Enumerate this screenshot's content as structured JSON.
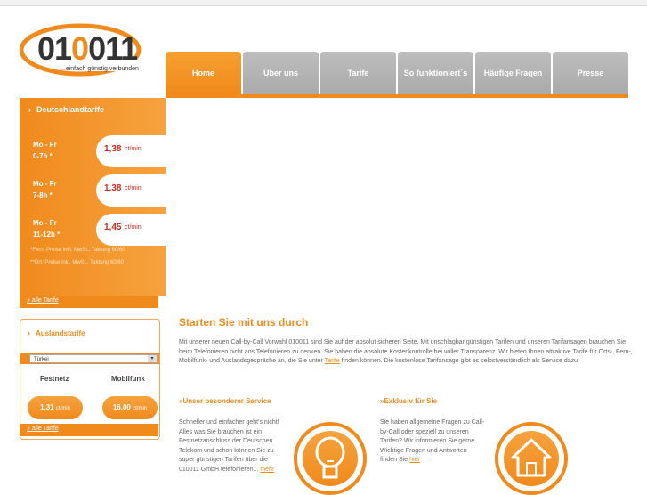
{
  "logo": {
    "text_prefix": "01",
    "text_mid": "0",
    "text_suffix": "011",
    "slogan": "...einfach günstig verbunden"
  },
  "nav": {
    "tabs": [
      {
        "label": "Home",
        "active": true
      },
      {
        "label": "Über uns"
      },
      {
        "label": "Tarife"
      },
      {
        "label": "So funktioniert´s"
      },
      {
        "label": "Häufige Fragen"
      },
      {
        "label": "Presse"
      }
    ]
  },
  "deutschland": {
    "title": "Deutschlandtarife",
    "rates": [
      {
        "day": "Mo - Fr",
        "time": "0-7h *",
        "price": "1,38",
        "unit": "ct/min"
      },
      {
        "day": "Mo - Fr",
        "time": "7-8h *",
        "price": "1,38",
        "unit": "ct/min"
      },
      {
        "day": "Mo - Fr",
        "time": "11-12h *",
        "price": "1,45",
        "unit": "ct/min"
      }
    ],
    "footnote1": "*Fern: Preise inkl. MwSt., Taktung 60/60",
    "footnote2": "**Ort: Preise inkl. MwSt., Taktung 60/60",
    "link": "» alle Tarife"
  },
  "ausland": {
    "title": "Auslandstarife",
    "selected": "Türkei",
    "festnetz_label": "Festnetz",
    "mobil_label": "Mobilfunk",
    "festnetz_price": "1,31",
    "mobil_price": "16,00",
    "unit": "ct/min",
    "link": "» alle Tarife"
  },
  "main": {
    "title": "Starten Sie mit uns durch",
    "intro_before": "Mit unserer neuen Call-by-Call Vorwahl 010011 sind Sie auf der absolut sicheren Seite. Mit unschlagbar günstigen Tarifen und unseren Tarifansagen brauchen Sie beim Telefonieren nicht ans Telefonieren zu denken. Sie haben die absolute Kostenkontrolle bei voller Transparenz. Wir bieten Ihnen attraktive Tarife für Orts-, Fern-, Mobilfunk- und Auslandsgespräche an, die Sie unter ",
    "intro_link": "Tarife",
    "intro_after": " finden können. Die kostenlose Tarifansage gibt es selbstverständlich als Service dazu.",
    "service_title": "»Unser besonderer Service",
    "service_text": "Schneller und einfacher geht's nicht! Alles was Sie brauchen ist ein Festnetzanschluss der Deutschen Telekom und schon können Sie zu super günstigen Tarifen über die 010011 GmbH telefonieren... ",
    "service_link": "mehr",
    "exklusiv_title": "»Exklusiv für Sie",
    "exklusiv_text": "Sie haben allgemeine Fragen zu Call-by-Call oder speziell zu unseren Tarifen? Wir informieren Sie gerne. Wichtige Fragen und Antworten finden Sie ",
    "exklusiv_link": "hier"
  }
}
